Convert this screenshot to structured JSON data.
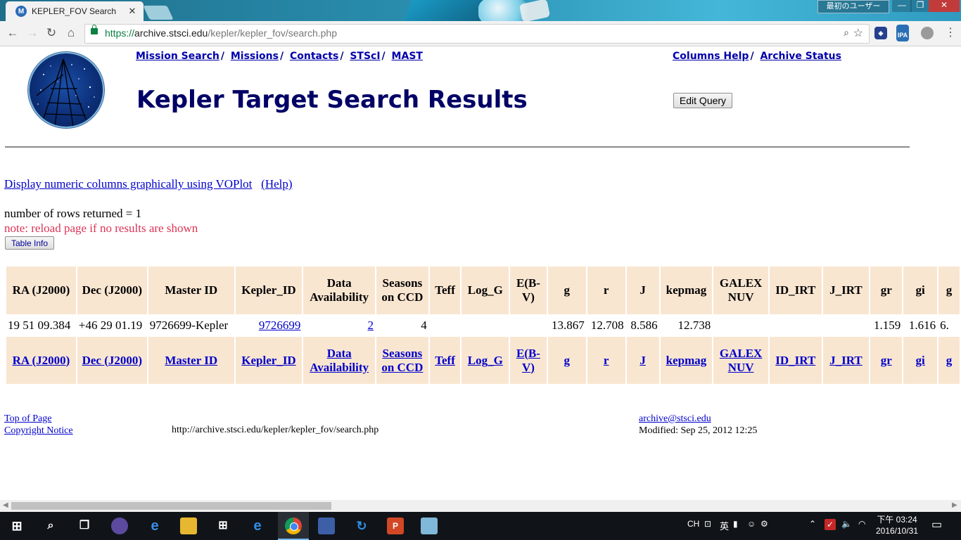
{
  "browser": {
    "tab_title": "KEPLER_FOV Search",
    "tab_favicon_letter": "M",
    "tab_close": "✕",
    "user_label": "最初のユーザー",
    "url_scheme": "https://",
    "url_host": "archive.stsci.edu",
    "url_path": "/kepler/kepler_fov/search.php",
    "ext_label": "IPA"
  },
  "nav": {
    "links": [
      "Mission Search",
      "Missions",
      "Contacts",
      "STScI",
      "MAST"
    ],
    "right_links": [
      "Columns Help",
      "Archive Status"
    ]
  },
  "page": {
    "title": "Kepler Target Search Results",
    "edit_query": "Edit Query",
    "voplot_link": "Display numeric columns graphically using VOPlot",
    "help_link": "(Help)",
    "row_count": "number of rows returned = 1",
    "note": "note: reload page if no results are shown",
    "table_info": "Table Info"
  },
  "table": {
    "headers": [
      "RA (J2000)",
      "Dec (J2000)",
      "Master ID",
      "Kepler_ID",
      "Data Availability",
      "Seasons on CCD",
      "Teff",
      "Log_G",
      "E(B-V)",
      "g",
      "r",
      "J",
      "kepmag",
      "GALEX NUV",
      "ID_IRT",
      "J_IRT",
      "gr",
      "gi",
      "g"
    ],
    "row": [
      "19 51 09.384",
      "+46 29 01.19",
      "9726699-Kepler",
      "9726699",
      "2",
      "4",
      "",
      "",
      "",
      "13.867",
      "12.708",
      "8.586",
      "12.738",
      "",
      "",
      "",
      "1.159",
      "1.616",
      "6."
    ]
  },
  "footer": {
    "top_link": "Top of Page",
    "copyright_link": "Copyright Notice",
    "page_url": "http://archive.stsci.edu/kepler/kepler_fov/search.php",
    "email": "archive@stsci.edu",
    "modified": "Modified: Sep 25, 2012 12:25"
  },
  "taskbar": {
    "tray_lang": "CH",
    "tray_ime": "英",
    "time": "下午 03:24",
    "date": "2016/10/31"
  }
}
